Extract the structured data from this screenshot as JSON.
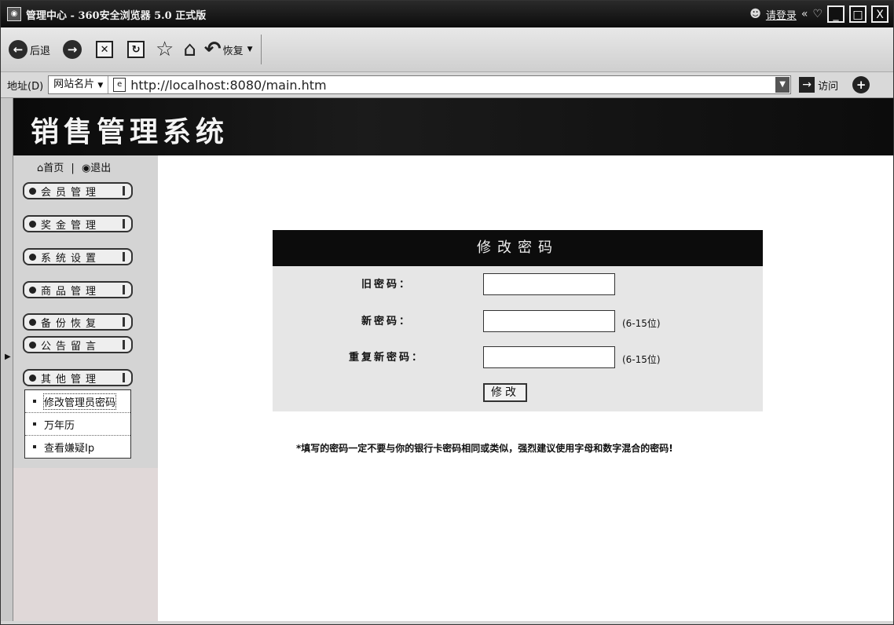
{
  "window": {
    "title": "管理中心 - 360安全浏览器 5.0 正式版",
    "login": "请登录",
    "extra_glyph": "«",
    "minimize": "_",
    "maximize": "□",
    "close": "X"
  },
  "toolbar": {
    "back_label": "后退",
    "restore_label": "恢复"
  },
  "address": {
    "label": "地址(D)",
    "favorites": "网站名片",
    "url": "http://localhost:8080/main.htm",
    "go_label": "访问"
  },
  "banner": {
    "brand": "销售管理系统"
  },
  "sidebar": {
    "home": "首页",
    "separator": "|",
    "logout": "退出",
    "menus": [
      "会员管理",
      "奖金管理",
      "系统设置",
      "商品管理",
      "备份恢复",
      "公告留言",
      "其他管理"
    ],
    "submenu": [
      "修改管理员密码",
      "万年历",
      "查看嫌疑Ip"
    ]
  },
  "form": {
    "title": "修改密码",
    "old_label": "旧密码：",
    "new_label": "新密码：",
    "repeat_label": "重复新密码：",
    "hint": "(6-15位)",
    "submit": "修改"
  },
  "warning": "*填写的密码一定不要与你的银行卡密码相同或类似，强烈建议使用字母和数字混合的密码!"
}
